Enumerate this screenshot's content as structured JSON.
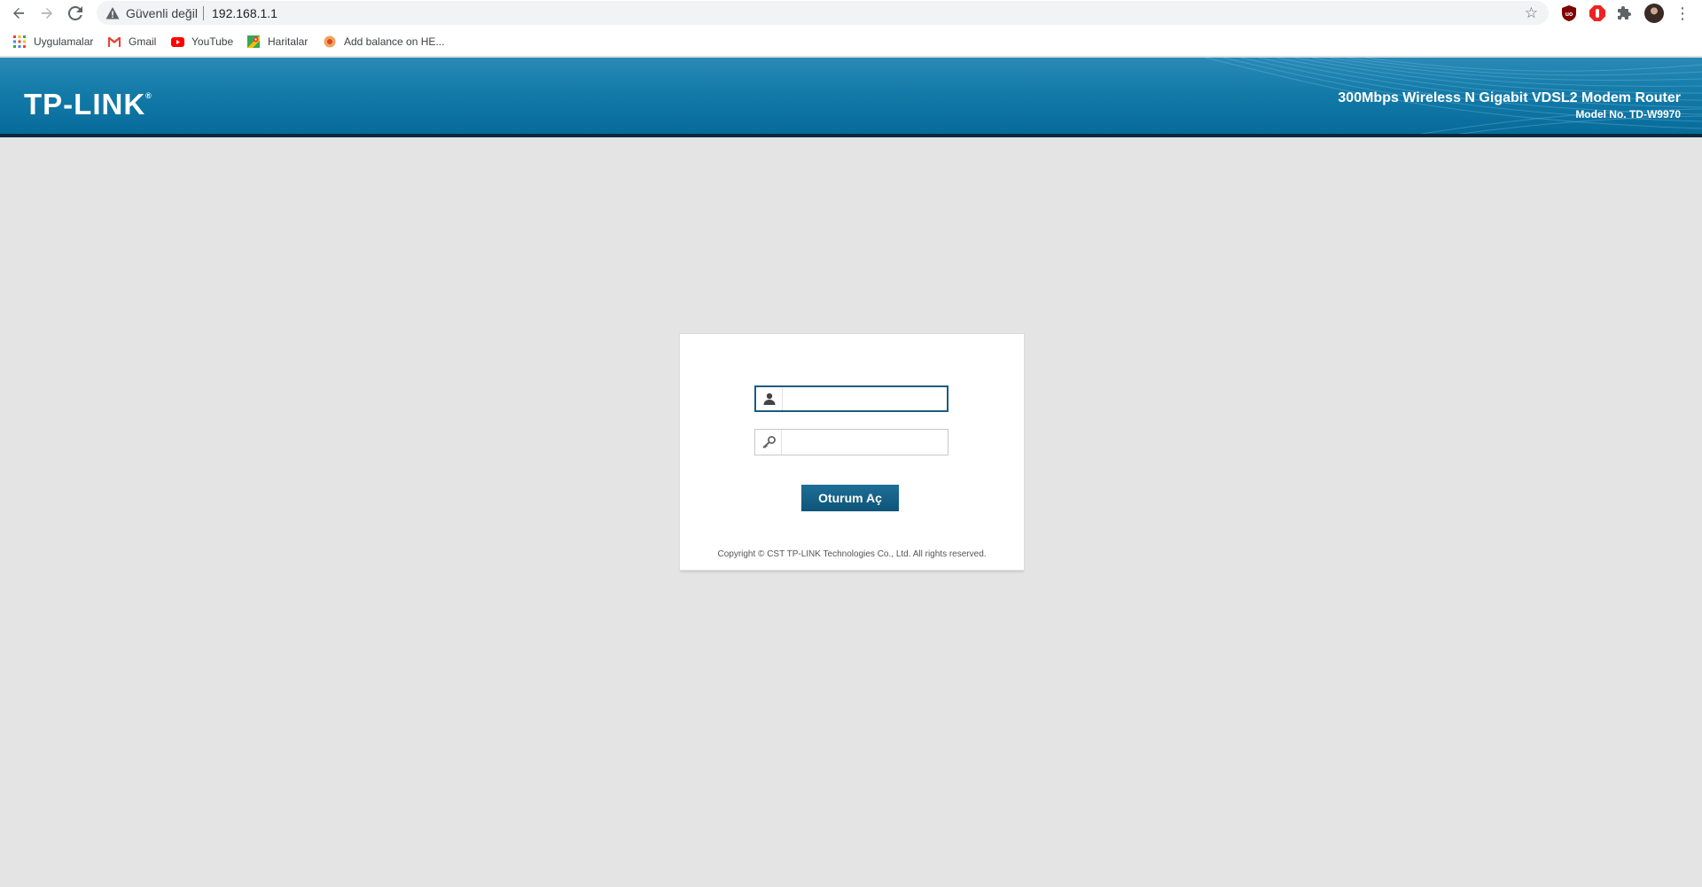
{
  "browser": {
    "security_label": "Güvenli değil",
    "url": "192.168.1.1",
    "bookmarks": [
      {
        "label": "Uygulamalar",
        "icon": "apps-grid-icon"
      },
      {
        "label": "Gmail",
        "icon": "gmail-icon"
      },
      {
        "label": "YouTube",
        "icon": "youtube-icon"
      },
      {
        "label": "Haritalar",
        "icon": "maps-icon"
      },
      {
        "label": "Add balance on HE...",
        "icon": "bookmark-favicon-icon"
      }
    ]
  },
  "router": {
    "logo_text": "TP-LINK",
    "logo_mark": "®",
    "product_name": "300Mbps Wireless N Gigabit VDSL2 Modem Router",
    "model": "Model No. TD-W9970"
  },
  "login": {
    "username_value": "",
    "password_value": "",
    "button_label": "Oturum Aç",
    "copyright": "Copyright © CST TP-LINK Technologies Co., Ltd. All rights reserved."
  },
  "colors": {
    "header_blue": "#137aa8",
    "button_blue": "#0e5479",
    "page_bg": "#e4e4e4"
  }
}
